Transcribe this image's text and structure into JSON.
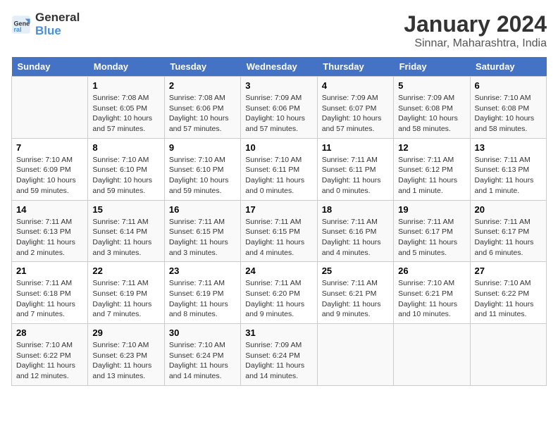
{
  "header": {
    "logo_line1": "General",
    "logo_line2": "Blue",
    "title": "January 2024",
    "subtitle": "Sinnar, Maharashtra, India"
  },
  "weekdays": [
    "Sunday",
    "Monday",
    "Tuesday",
    "Wednesday",
    "Thursday",
    "Friday",
    "Saturday"
  ],
  "weeks": [
    [
      {
        "day": "",
        "info": ""
      },
      {
        "day": "1",
        "info": "Sunrise: 7:08 AM\nSunset: 6:05 PM\nDaylight: 10 hours\nand 57 minutes."
      },
      {
        "day": "2",
        "info": "Sunrise: 7:08 AM\nSunset: 6:06 PM\nDaylight: 10 hours\nand 57 minutes."
      },
      {
        "day": "3",
        "info": "Sunrise: 7:09 AM\nSunset: 6:06 PM\nDaylight: 10 hours\nand 57 minutes."
      },
      {
        "day": "4",
        "info": "Sunrise: 7:09 AM\nSunset: 6:07 PM\nDaylight: 10 hours\nand 57 minutes."
      },
      {
        "day": "5",
        "info": "Sunrise: 7:09 AM\nSunset: 6:08 PM\nDaylight: 10 hours\nand 58 minutes."
      },
      {
        "day": "6",
        "info": "Sunrise: 7:10 AM\nSunset: 6:08 PM\nDaylight: 10 hours\nand 58 minutes."
      }
    ],
    [
      {
        "day": "7",
        "info": "Sunrise: 7:10 AM\nSunset: 6:09 PM\nDaylight: 10 hours\nand 59 minutes."
      },
      {
        "day": "8",
        "info": "Sunrise: 7:10 AM\nSunset: 6:10 PM\nDaylight: 10 hours\nand 59 minutes."
      },
      {
        "day": "9",
        "info": "Sunrise: 7:10 AM\nSunset: 6:10 PM\nDaylight: 10 hours\nand 59 minutes."
      },
      {
        "day": "10",
        "info": "Sunrise: 7:10 AM\nSunset: 6:11 PM\nDaylight: 11 hours\nand 0 minutes."
      },
      {
        "day": "11",
        "info": "Sunrise: 7:11 AM\nSunset: 6:11 PM\nDaylight: 11 hours\nand 0 minutes."
      },
      {
        "day": "12",
        "info": "Sunrise: 7:11 AM\nSunset: 6:12 PM\nDaylight: 11 hours\nand 1 minute."
      },
      {
        "day": "13",
        "info": "Sunrise: 7:11 AM\nSunset: 6:13 PM\nDaylight: 11 hours\nand 1 minute."
      }
    ],
    [
      {
        "day": "14",
        "info": "Sunrise: 7:11 AM\nSunset: 6:13 PM\nDaylight: 11 hours\nand 2 minutes."
      },
      {
        "day": "15",
        "info": "Sunrise: 7:11 AM\nSunset: 6:14 PM\nDaylight: 11 hours\nand 3 minutes."
      },
      {
        "day": "16",
        "info": "Sunrise: 7:11 AM\nSunset: 6:15 PM\nDaylight: 11 hours\nand 3 minutes."
      },
      {
        "day": "17",
        "info": "Sunrise: 7:11 AM\nSunset: 6:15 PM\nDaylight: 11 hours\nand 4 minutes."
      },
      {
        "day": "18",
        "info": "Sunrise: 7:11 AM\nSunset: 6:16 PM\nDaylight: 11 hours\nand 4 minutes."
      },
      {
        "day": "19",
        "info": "Sunrise: 7:11 AM\nSunset: 6:17 PM\nDaylight: 11 hours\nand 5 minutes."
      },
      {
        "day": "20",
        "info": "Sunrise: 7:11 AM\nSunset: 6:17 PM\nDaylight: 11 hours\nand 6 minutes."
      }
    ],
    [
      {
        "day": "21",
        "info": "Sunrise: 7:11 AM\nSunset: 6:18 PM\nDaylight: 11 hours\nand 7 minutes."
      },
      {
        "day": "22",
        "info": "Sunrise: 7:11 AM\nSunset: 6:19 PM\nDaylight: 11 hours\nand 7 minutes."
      },
      {
        "day": "23",
        "info": "Sunrise: 7:11 AM\nSunset: 6:19 PM\nDaylight: 11 hours\nand 8 minutes."
      },
      {
        "day": "24",
        "info": "Sunrise: 7:11 AM\nSunset: 6:20 PM\nDaylight: 11 hours\nand 9 minutes."
      },
      {
        "day": "25",
        "info": "Sunrise: 7:11 AM\nSunset: 6:21 PM\nDaylight: 11 hours\nand 9 minutes."
      },
      {
        "day": "26",
        "info": "Sunrise: 7:10 AM\nSunset: 6:21 PM\nDaylight: 11 hours\nand 10 minutes."
      },
      {
        "day": "27",
        "info": "Sunrise: 7:10 AM\nSunset: 6:22 PM\nDaylight: 11 hours\nand 11 minutes."
      }
    ],
    [
      {
        "day": "28",
        "info": "Sunrise: 7:10 AM\nSunset: 6:22 PM\nDaylight: 11 hours\nand 12 minutes."
      },
      {
        "day": "29",
        "info": "Sunrise: 7:10 AM\nSunset: 6:23 PM\nDaylight: 11 hours\nand 13 minutes."
      },
      {
        "day": "30",
        "info": "Sunrise: 7:10 AM\nSunset: 6:24 PM\nDaylight: 11 hours\nand 14 minutes."
      },
      {
        "day": "31",
        "info": "Sunrise: 7:09 AM\nSunset: 6:24 PM\nDaylight: 11 hours\nand 14 minutes."
      },
      {
        "day": "",
        "info": ""
      },
      {
        "day": "",
        "info": ""
      },
      {
        "day": "",
        "info": ""
      }
    ]
  ]
}
